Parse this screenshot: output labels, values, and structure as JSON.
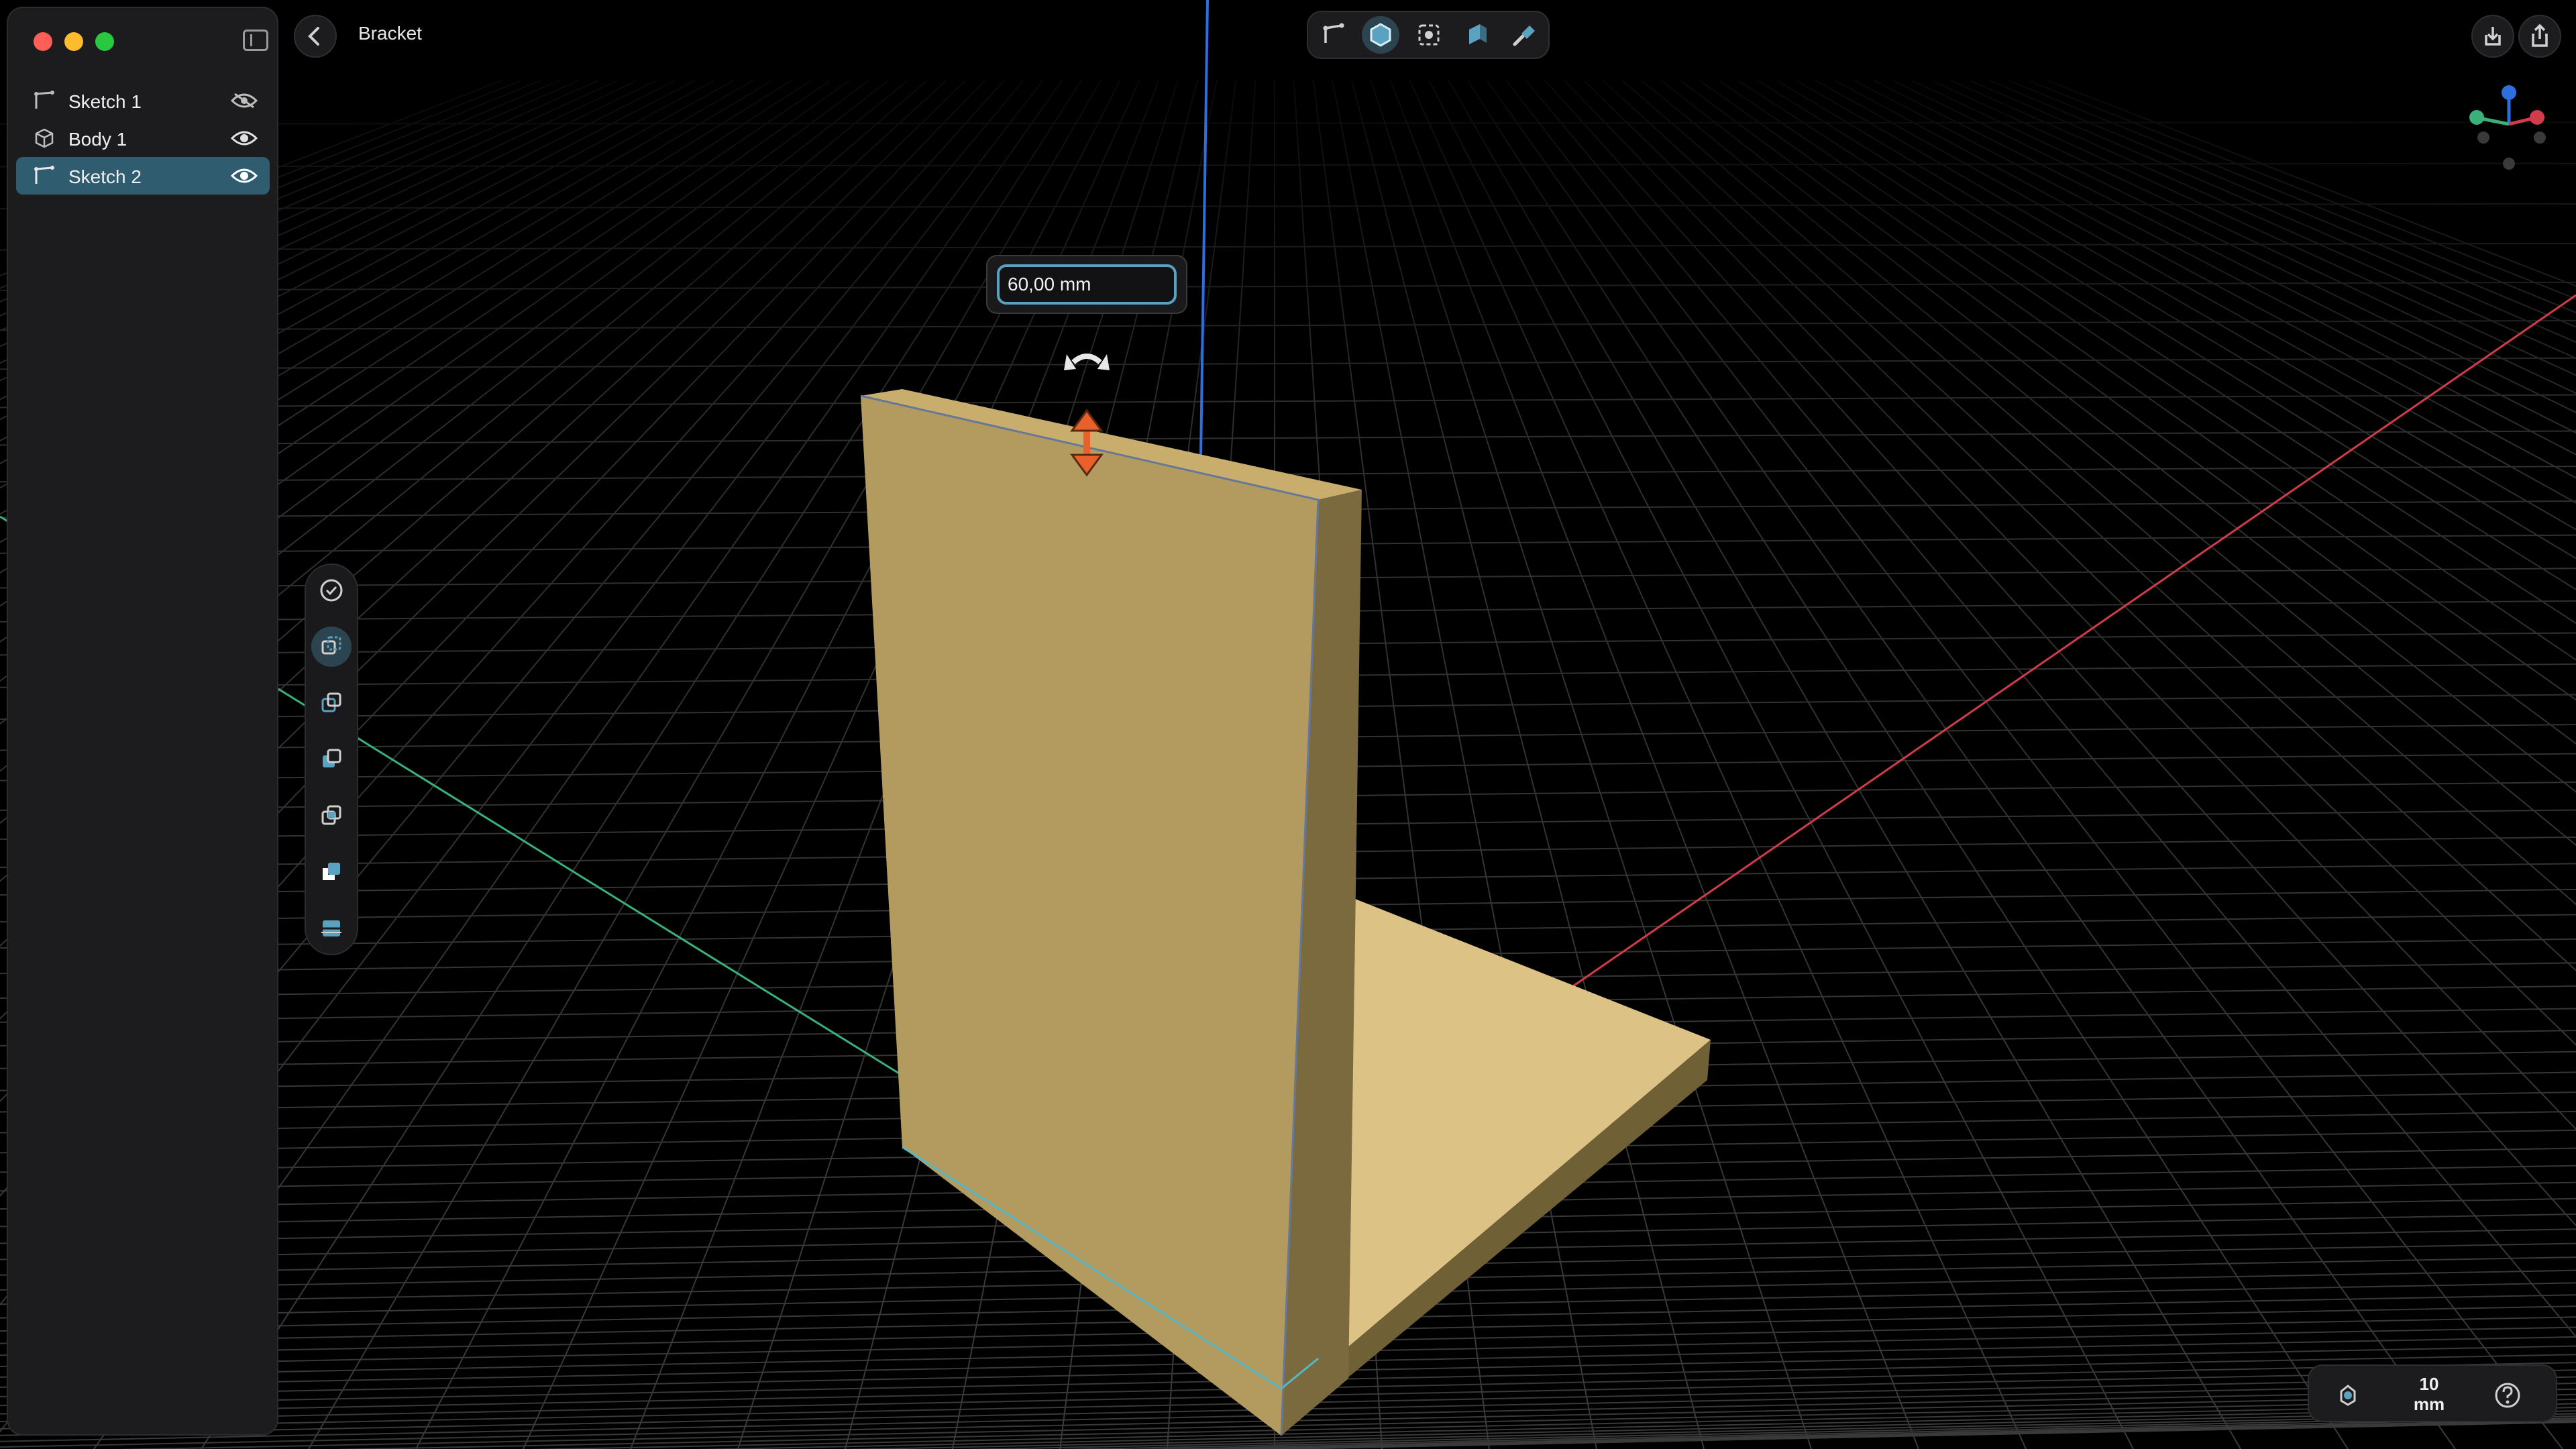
{
  "window": {
    "title": "Bracket",
    "traffic_lights": {
      "close": "#ff5f57",
      "minimize": "#febc2e",
      "maximize": "#28c840"
    }
  },
  "sidebar": {
    "items": [
      {
        "label": "Sketch 1",
        "icon": "sketch-icon",
        "visibility": "hidden-eye-icon",
        "selected": false
      },
      {
        "label": "Body 1",
        "icon": "body-cube-icon",
        "visibility": "eye-icon",
        "selected": false
      },
      {
        "label": "Sketch 2",
        "icon": "sketch-icon",
        "visibility": "eye-icon",
        "selected": true
      }
    ]
  },
  "toolbar": {
    "modes": [
      "sketch-mode-icon",
      "solid-mode-icon",
      "select-mode-icon",
      "extrude-mode-icon",
      "paint-mode-icon"
    ],
    "active_mode": "solid-mode-icon",
    "right_buttons": [
      "import-icon",
      "share-icon"
    ]
  },
  "tools": {
    "items": [
      "confirm-icon",
      "new-body-icon",
      "join-icon",
      "cut-icon",
      "intersect-icon",
      "subtract-icon",
      "split-icon"
    ],
    "active": "new-body-icon"
  },
  "dimension": {
    "value": "60,00 mm"
  },
  "status": {
    "scale_value": "10",
    "scale_unit": "mm"
  },
  "colors": {
    "accent": "#5aa2c0",
    "selection": "#2f5d6f",
    "body_face": "#b39a5f",
    "body_top": "#dcc285",
    "axis_x": "#d23c4a",
    "axis_y": "#3ab07a",
    "axis_z": "#2e6fe0",
    "handle": "#e8612c"
  }
}
